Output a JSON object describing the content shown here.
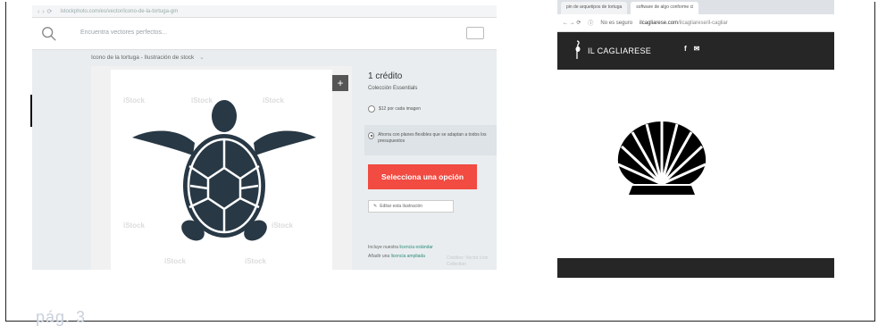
{
  "page_number": "pág. 3",
  "left_screenshot": {
    "url_text": "istockphoto.com/es/vector/icono-de-la-tortuga-gm",
    "search_placeholder": "Encuentra vectores perfectos...",
    "breadcrumb": "Icono de la tortuga - Ilustración de stock",
    "watermark": "iStock",
    "panel": {
      "credit_title": "1 crédito",
      "collection": "Colección Essentials",
      "option1": "$12 por cada imagen",
      "option2": "Ahorra con planes flexibles que se adaptan a todos los presupuestos",
      "select_button": "Selecciona una opción",
      "edit_button": "Editar esta ilustración",
      "footer1_prefix": "Incluye nuestra ",
      "footer1_link": "licencia estándar",
      "footer2_prefix": "Añadir una ",
      "footer2_link": "licencia ampliada"
    },
    "footer_watermark": "Créditos: Vector\nIcon Collection"
  },
  "right_screenshot": {
    "tabs": [
      "pin de arquetipos de tortuga",
      "software de algo conforme ci"
    ],
    "url_security": "No es seguro",
    "url_domain": "ilcagliarese.com",
    "url_path": "/ilcagliarese/il-cagliar",
    "brand": "IL CAGLIARESE",
    "social": [
      "f",
      "✉"
    ]
  },
  "colors": {
    "accent_red": "#f14b42",
    "icon_dark": "#283845",
    "header_dark": "#262626",
    "link_green": "#2f8c7c"
  }
}
